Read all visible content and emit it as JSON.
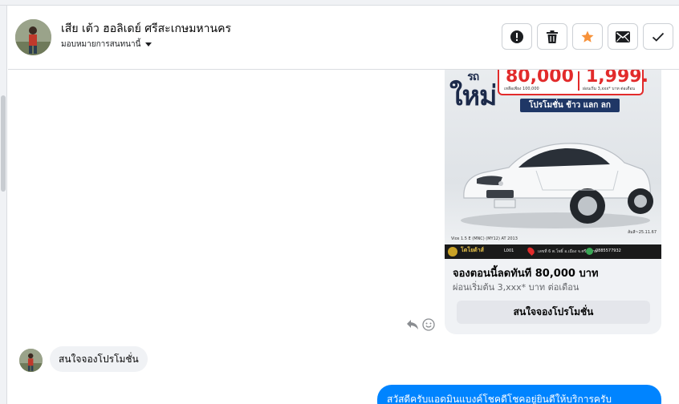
{
  "header": {
    "contact_name": "เสีย เต้ว ฮอลิเดย์ ศรีสะเกษมหานคร",
    "assign_label": "มอบหมายการสนทนานี้"
  },
  "actions": [
    {
      "name": "alert-icon",
      "label": "Mark as spam"
    },
    {
      "name": "trash-icon",
      "label": "Delete"
    },
    {
      "name": "star-icon",
      "label": "Star"
    },
    {
      "name": "envelope-icon",
      "label": "Mark as unread"
    },
    {
      "name": "check-icon",
      "label": "Mark as done"
    }
  ],
  "promo_image": {
    "big_word_top": "รถ",
    "big_word": "ใหม่",
    "price_down": "80,000",
    "price_monthly": "1,999.",
    "price_down_note": "เหลือเพียง 100,000",
    "price_monthly_note": "ผ่อนเริ่ม 3,xxx* บาท ต่อเดือน",
    "banner": "โปรโมชั่น ช้าว แลก ลก",
    "model_text": "Vios 1.5 E (MNC) (MY12) AT 2013",
    "side_note": "ส้มสี~25.11.67",
    "footer_brand": "โตโยต้าส์",
    "footer_code": "L001",
    "footer_address": "เลขที่ 6 ต.โพธิ์ อ.เมือง จ.ศรีสะเกษ",
    "footer_phone": "0885577932"
  },
  "card": {
    "title": "จองตอนนี้ลดทันที 80,000 บาท",
    "subtitle": "ผ่อนเริ่มต้น 3,xxx* บาท ต่อเดือน",
    "button_label": "สนใจจองโปรโมชั่น"
  },
  "messages": {
    "incoming_text": "สนใจจองโปรโมชั่น",
    "outgoing_text": "สวัสดีครับแอดมินแบงค์โชคดีโชคอยู่ยินดีให้บริการครับ"
  },
  "colors": {
    "accent_blue": "#0084ff",
    "star_orange": "#f7923a",
    "promo_red": "#e22b2b",
    "banner_navy": "#1f3766"
  }
}
